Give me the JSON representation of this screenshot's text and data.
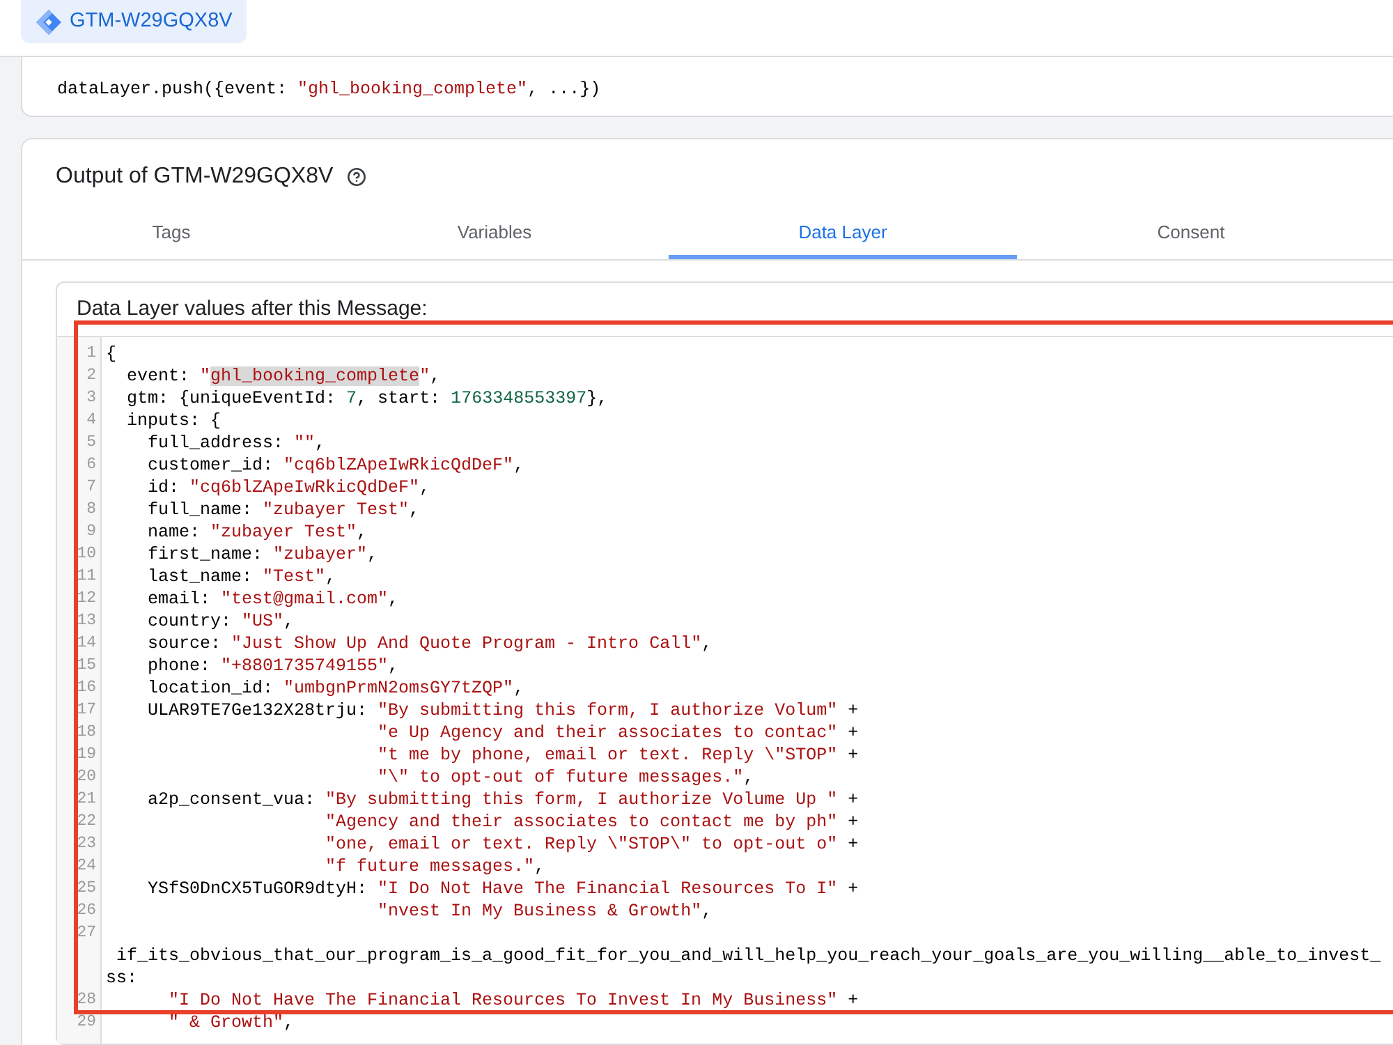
{
  "header": {
    "container_id": "GTM-W29GQX8V"
  },
  "message_card": {
    "code": [
      {
        "kind": "plain",
        "text": "dataLayer.push({event: "
      },
      {
        "kind": "string",
        "text": "\"ghl_booking_complete\""
      },
      {
        "kind": "plain",
        "text": ", ...})"
      }
    ]
  },
  "output_panel": {
    "title": "Output of GTM-W29GQX8V",
    "tabs": [
      {
        "label": "Tags",
        "selected": false
      },
      {
        "label": "Variables",
        "selected": false
      },
      {
        "label": "Data Layer",
        "selected": true
      },
      {
        "label": "Consent",
        "selected": false
      }
    ],
    "values_box": {
      "label": "Data Layer values after this Message:",
      "code_lines": [
        {
          "number": "1",
          "tokens": [
            {
              "kind": "plain",
              "text": "{"
            }
          ],
          "children": [
            {
              "number": "2",
              "tokens": [
                {
                  "kind": "plain",
                  "text": "event: "
                },
                {
                  "kind": "string",
                  "text": "\""
                },
                {
                  "kind": "match",
                  "text": "ghl_booking_complete"
                },
                {
                  "kind": "string",
                  "text": "\""
                },
                {
                  "kind": "plain",
                  "text": ","
                }
              ]
            },
            {
              "number": "3",
              "tokens": [
                {
                  "kind": "plain",
                  "text": "gtm: {uniqueEventId: "
                },
                {
                  "kind": "number",
                  "text": "7"
                },
                {
                  "kind": "plain",
                  "text": ", start: "
                },
                {
                  "kind": "number",
                  "text": "1763348553397"
                },
                {
                  "kind": "plain",
                  "text": "},"
                }
              ]
            },
            {
              "number": "4",
              "tokens": [
                {
                  "kind": "plain",
                  "text": "inputs: {"
                }
              ],
              "children": [
                {
                  "number": "5",
                  "tokens": [
                    {
                      "kind": "plain",
                      "text": "full_address: "
                    },
                    {
                      "kind": "string",
                      "text": "\"\""
                    },
                    {
                      "kind": "plain",
                      "text": ","
                    }
                  ]
                },
                {
                  "number": "6",
                  "tokens": [
                    {
                      "kind": "plain",
                      "text": "customer_id: "
                    },
                    {
                      "kind": "string",
                      "text": "\"cq6blZApeIwRkicQdDeF\""
                    },
                    {
                      "kind": "plain",
                      "text": ","
                    }
                  ]
                },
                {
                  "number": "7",
                  "tokens": [
                    {
                      "kind": "plain",
                      "text": "id: "
                    },
                    {
                      "kind": "string",
                      "text": "\"cq6blZApeIwRkicQdDeF\""
                    },
                    {
                      "kind": "plain",
                      "text": ","
                    }
                  ]
                },
                {
                  "number": "8",
                  "tokens": [
                    {
                      "kind": "plain",
                      "text": "full_name: "
                    },
                    {
                      "kind": "string",
                      "text": "\"zubayer Test\""
                    },
                    {
                      "kind": "plain",
                      "text": ","
                    }
                  ]
                },
                {
                  "number": "9",
                  "tokens": [
                    {
                      "kind": "plain",
                      "text": "name: "
                    },
                    {
                      "kind": "string",
                      "text": "\"zubayer Test\""
                    },
                    {
                      "kind": "plain",
                      "text": ","
                    }
                  ]
                },
                {
                  "number": "10",
                  "tokens": [
                    {
                      "kind": "plain",
                      "text": "first_name: "
                    },
                    {
                      "kind": "string",
                      "text": "\"zubayer\""
                    },
                    {
                      "kind": "plain",
                      "text": ","
                    }
                  ]
                },
                {
                  "number": "11",
                  "tokens": [
                    {
                      "kind": "plain",
                      "text": "last_name: "
                    },
                    {
                      "kind": "string",
                      "text": "\"Test\""
                    },
                    {
                      "kind": "plain",
                      "text": ","
                    }
                  ]
                },
                {
                  "number": "12",
                  "tokens": [
                    {
                      "kind": "plain",
                      "text": "email: "
                    },
                    {
                      "kind": "string",
                      "text": "\"test@gmail.com\""
                    },
                    {
                      "kind": "plain",
                      "text": ","
                    }
                  ]
                },
                {
                  "number": "13",
                  "tokens": [
                    {
                      "kind": "plain",
                      "text": "country: "
                    },
                    {
                      "kind": "string",
                      "text": "\"US\""
                    },
                    {
                      "kind": "plain",
                      "text": ","
                    }
                  ]
                },
                {
                  "number": "14",
                  "tokens": [
                    {
                      "kind": "plain",
                      "text": "source: "
                    },
                    {
                      "kind": "string",
                      "text": "\"Just Show Up And Quote Program - Intro Call\""
                    },
                    {
                      "kind": "plain",
                      "text": ","
                    }
                  ]
                },
                {
                  "number": "15",
                  "tokens": [
                    {
                      "kind": "plain",
                      "text": "phone: "
                    },
                    {
                      "kind": "string",
                      "text": "\"+8801735749155\""
                    },
                    {
                      "kind": "plain",
                      "text": ","
                    }
                  ]
                },
                {
                  "number": "16",
                  "tokens": [
                    {
                      "kind": "plain",
                      "text": "location_id: "
                    },
                    {
                      "kind": "string",
                      "text": "\"umbgnPrmN2omsGY7tZQP\""
                    },
                    {
                      "kind": "plain",
                      "text": ","
                    }
                  ]
                },
                {
                  "number": "17",
                  "tokens": [
                    {
                      "kind": "plain",
                      "text": "ULAR9TE7Ge132X28trju: "
                    },
                    {
                      "kind": "string",
                      "text": "\"By submitting this form, I authorize Volum\""
                    },
                    {
                      "kind": "plain",
                      "text": " +"
                    }
                  ],
                  "continuation_lines": [
                    {
                      "number": "18",
                      "tokens": [
                        {
                          "kind": "string",
                          "text": "\"e Up Agency and their associates to contac\""
                        },
                        {
                          "kind": "plain",
                          "text": " +"
                        }
                      ]
                    },
                    {
                      "number": "19",
                      "tokens": [
                        {
                          "kind": "string",
                          "text": "\"t me by phone, email or text. Reply \\\"STOP\""
                        },
                        {
                          "kind": "plain",
                          "text": " +"
                        }
                      ]
                    },
                    {
                      "number": "20",
                      "tokens": [
                        {
                          "kind": "string",
                          "text": "\"\\\" to opt-out of future messages.\""
                        },
                        {
                          "kind": "plain",
                          "text": ","
                        }
                      ]
                    }
                  ]
                },
                {
                  "number": "21",
                  "tokens": [
                    {
                      "kind": "plain",
                      "text": "a2p_consent_vua: "
                    },
                    {
                      "kind": "string",
                      "text": "\"By submitting this form, I authorize Volume Up \""
                    },
                    {
                      "kind": "plain",
                      "text": " +"
                    }
                  ],
                  "continuation_lines": [
                    {
                      "number": "22",
                      "tokens": [
                        {
                          "kind": "string",
                          "text": "\"Agency and their associates to contact me by ph\""
                        },
                        {
                          "kind": "plain",
                          "text": " +"
                        }
                      ]
                    },
                    {
                      "number": "23",
                      "tokens": [
                        {
                          "kind": "string",
                          "text": "\"one, email or text. Reply \\\"STOP\\\" to opt-out o\""
                        },
                        {
                          "kind": "plain",
                          "text": " +"
                        }
                      ]
                    },
                    {
                      "number": "24",
                      "tokens": [
                        {
                          "kind": "string",
                          "text": "\"f future messages.\""
                        },
                        {
                          "kind": "plain",
                          "text": ","
                        }
                      ]
                    }
                  ]
                },
                {
                  "number": "25",
                  "tokens": [
                    {
                      "kind": "plain",
                      "text": "YSfS0DnCX5TuGOR9dtyH: "
                    },
                    {
                      "kind": "string",
                      "text": "\"I Do Not Have The Financial Resources To I\""
                    },
                    {
                      "kind": "plain",
                      "text": " +"
                    }
                  ],
                  "continuation_lines": [
                    {
                      "number": "26",
                      "tokens": [
                        {
                          "kind": "string",
                          "text": "\"nvest In My Business & Growth\""
                        },
                        {
                          "kind": "plain",
                          "text": ","
                        }
                      ]
                    }
                  ]
                },
                {
                  "number": "27",
                  "wrapped_rows": [
                    {
                      "tokens": [
                        {
                          "kind": "plain",
                          "text": " if_its_obvious_that_our_program_is_a_good_fit_for_you_and_will_help_you_reach_your_goals_are_you_willing__able_to_invest_"
                        }
                      ]
                    },
                    {
                      "tokens": [
                        {
                          "kind": "plain",
                          "text": "ss:"
                        }
                      ]
                    }
                  ],
                  "children": [
                    {
                      "number": "28",
                      "tokens": [
                        {
                          "kind": "string",
                          "text": "\"I Do Not Have The Financial Resources To Invest In My Business\""
                        },
                        {
                          "kind": "plain",
                          "text": " +"
                        }
                      ]
                    },
                    {
                      "number": "29",
                      "tokens": [
                        {
                          "kind": "string",
                          "text": "\" & Growth\""
                        },
                        {
                          "kind": "plain",
                          "text": ","
                        }
                      ]
                    }
                  ]
                }
              ]
            }
          ]
        }
      ]
    }
  }
}
